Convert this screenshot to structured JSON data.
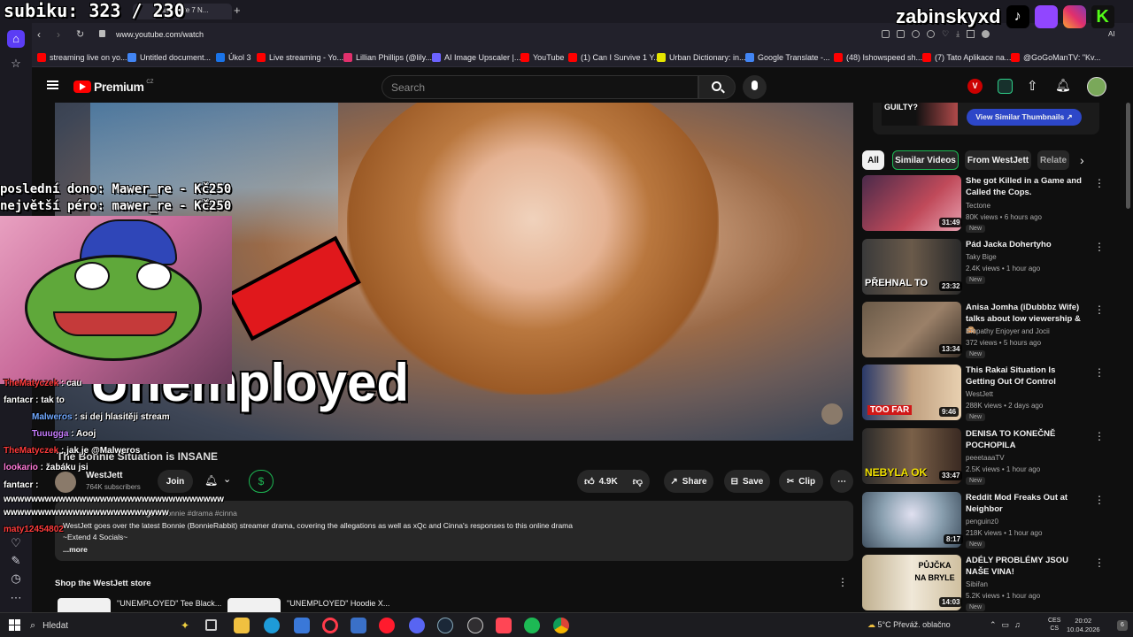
{
  "stream_overlay": {
    "sub_counter": "subiku: 323 / 230",
    "streamer_name": "zabinskyxd",
    "last_donation": "poslední dono: Mawer_re - Kč250",
    "biggest_donation": "největší péro: mawer_re - Kč250",
    "thumbnail_word": "Unemployed",
    "chat": [
      {
        "user": "TheMatyczek",
        "message": "cau",
        "color": "#ff3b3b"
      },
      {
        "user": "fantacr",
        "message": "tak to",
        "color": "#ffffff"
      },
      {
        "user": "Malweros",
        "message": "si dej hlasitěji stream",
        "color": "#6fa8ff"
      },
      {
        "user": "Tuuugga",
        "message": "Aooj",
        "color": "#c77dff"
      },
      {
        "user": "TheMatyczek",
        "message": "jak je @Malweros",
        "color": "#ff3b3b"
      },
      {
        "user": "lookario",
        "message": "žabáku jsi",
        "color": "#ff7ad9"
      },
      {
        "user": "fantacr",
        "message": "",
        "color": "#ffffff"
      },
      {
        "user": "",
        "message": "wwwwwwwwwwwwwwwwwwwwwwwwwwwwwwww",
        "color": "#ffffff"
      },
      {
        "user": "",
        "message": "wwwwwwwwwwwwwwwwwwwwwwww",
        "color": "#ffffff"
      },
      {
        "user": "maty12454802",
        "message": "",
        "color": "#ff3b3b"
      }
    ]
  },
  "browser": {
    "tab_title": "...and Date 7 N...",
    "url": "www.youtube.com/watch",
    "bookmarks": [
      {
        "label": "streaming live on yo...",
        "color": "#ff0000"
      },
      {
        "label": "Untitled document...",
        "color": "#4285f4"
      },
      {
        "label": "Úkol 3",
        "color": "#1a73e8"
      },
      {
        "label": "Live streaming - Yo...",
        "color": "#ff0000"
      },
      {
        "label": "Lillian Phillips (@lily...",
        "color": "#e1306c"
      },
      {
        "label": "AI Image Upscaler |...",
        "color": "#6c63ff"
      },
      {
        "label": "YouTube",
        "color": "#ff0000"
      },
      {
        "label": "(1) Can I Survive 1 Y...",
        "color": "#ff0000"
      },
      {
        "label": "Urban Dictionary: in...",
        "color": "#e6e600"
      },
      {
        "label": "Google Translate -...",
        "color": "#4285f4"
      },
      {
        "label": "(48) Ishowspeed sh...",
        "color": "#ff0000"
      },
      {
        "label": "(7) Tato Aplikace na...",
        "color": "#ff0000"
      },
      {
        "label": "@GoGoManTV: \"Kv...",
        "color": "#ff0000"
      }
    ]
  },
  "youtube": {
    "logo_text": "Premium",
    "region": "CZ",
    "search_placeholder": "Search",
    "video": {
      "title": "The Bonnie Situation is INSANE",
      "channel": "WestJett",
      "subscribers": "764K subscribers",
      "join_label": "Join",
      "likes": "4.9K",
      "share_label": "Share",
      "save_label": "Save",
      "clip_label": "Clip",
      "hashtags": "#bonnie #drama #cinna",
      "description": "WestJett goes over the latest Bonnie (BonnieRabbit) streamer drama, covering the allegations as well as xQc and Cinna's responses to this online drama",
      "socials": "~Extend 4 Socials~",
      "more": "...more",
      "time_ago": "go"
    },
    "store": {
      "heading": "Shop the WestJett store",
      "items": [
        "\"UNEMPLOYED\" Tee Black...",
        "\"UNEMPLOYED\" Hoodie X..."
      ]
    },
    "sidebar_top": {
      "guilty_text": "GUILTY?",
      "view_similar": "View Similar Thumbnails"
    },
    "chips": [
      "All",
      "Similar Videos",
      "From WestJett",
      "Relate"
    ],
    "related": [
      {
        "title": "She got Killed in a Game and Called the Cops.",
        "channel": "Tectone",
        "meta": "80K views • 6 hours ago",
        "duration": "31:49",
        "badge": "New",
        "thumb": "#6b2a3a"
      },
      {
        "title": "Pád Jacka Dohertyho",
        "channel": "Taky Bige",
        "meta": "2.4K views • 1 hour ago",
        "duration": "23:32",
        "badge": "New",
        "thumb_text": "PŘEHNAL TO",
        "thumb": "#2a2a2a"
      },
      {
        "title": "Anisa Jomha (iDubbbz Wife) talks about low viewership & 🙈",
        "channel": "Empathy Enjoyer and Jocii",
        "meta": "372 views • 5 hours ago",
        "duration": "13:34",
        "badge": "New",
        "thumb": "#5a4636"
      },
      {
        "title": "This Rakai Situation Is Getting Out Of Control",
        "channel": "WestJett",
        "meta": "288K views • 2 days ago",
        "duration": "9:46",
        "badge": "New",
        "thumb_text": "TOO FAR",
        "thumb": "#3a4a7a"
      },
      {
        "title": "DENISA TO KONEČNĚ POCHOPILA",
        "channel": "peeetaaaTV",
        "meta": "2.5K views • 1 hour ago",
        "duration": "33:47",
        "badge": "New",
        "thumb_text": "NEBYLA OK",
        "thumb": "#4a3a2a"
      },
      {
        "title": "Reddit Mod Freaks Out at Neighbor",
        "channel": "penguinz0",
        "meta": "218K views • 1 hour ago",
        "duration": "8:17",
        "badge": "New",
        "thumb": "#6a8aa0"
      },
      {
        "title": "ADÉLY PROBLÉMY JSOU NAŠE VINA!",
        "channel": "Sibiřan",
        "meta": "5.2K views • 1 hour ago",
        "duration": "14:03",
        "badge": "New",
        "thumb_text": "PŮJČKA NA BRYLE",
        "thumb": "#e8e0d0"
      }
    ]
  },
  "taskbar": {
    "search_label": "Hledat",
    "weather": "5°C  Převáž. oblačno",
    "lang": "CES\nCS",
    "lang_top": "CES",
    "lang_bottom": "CS",
    "time": "20:02",
    "date": "10.04.2026"
  }
}
